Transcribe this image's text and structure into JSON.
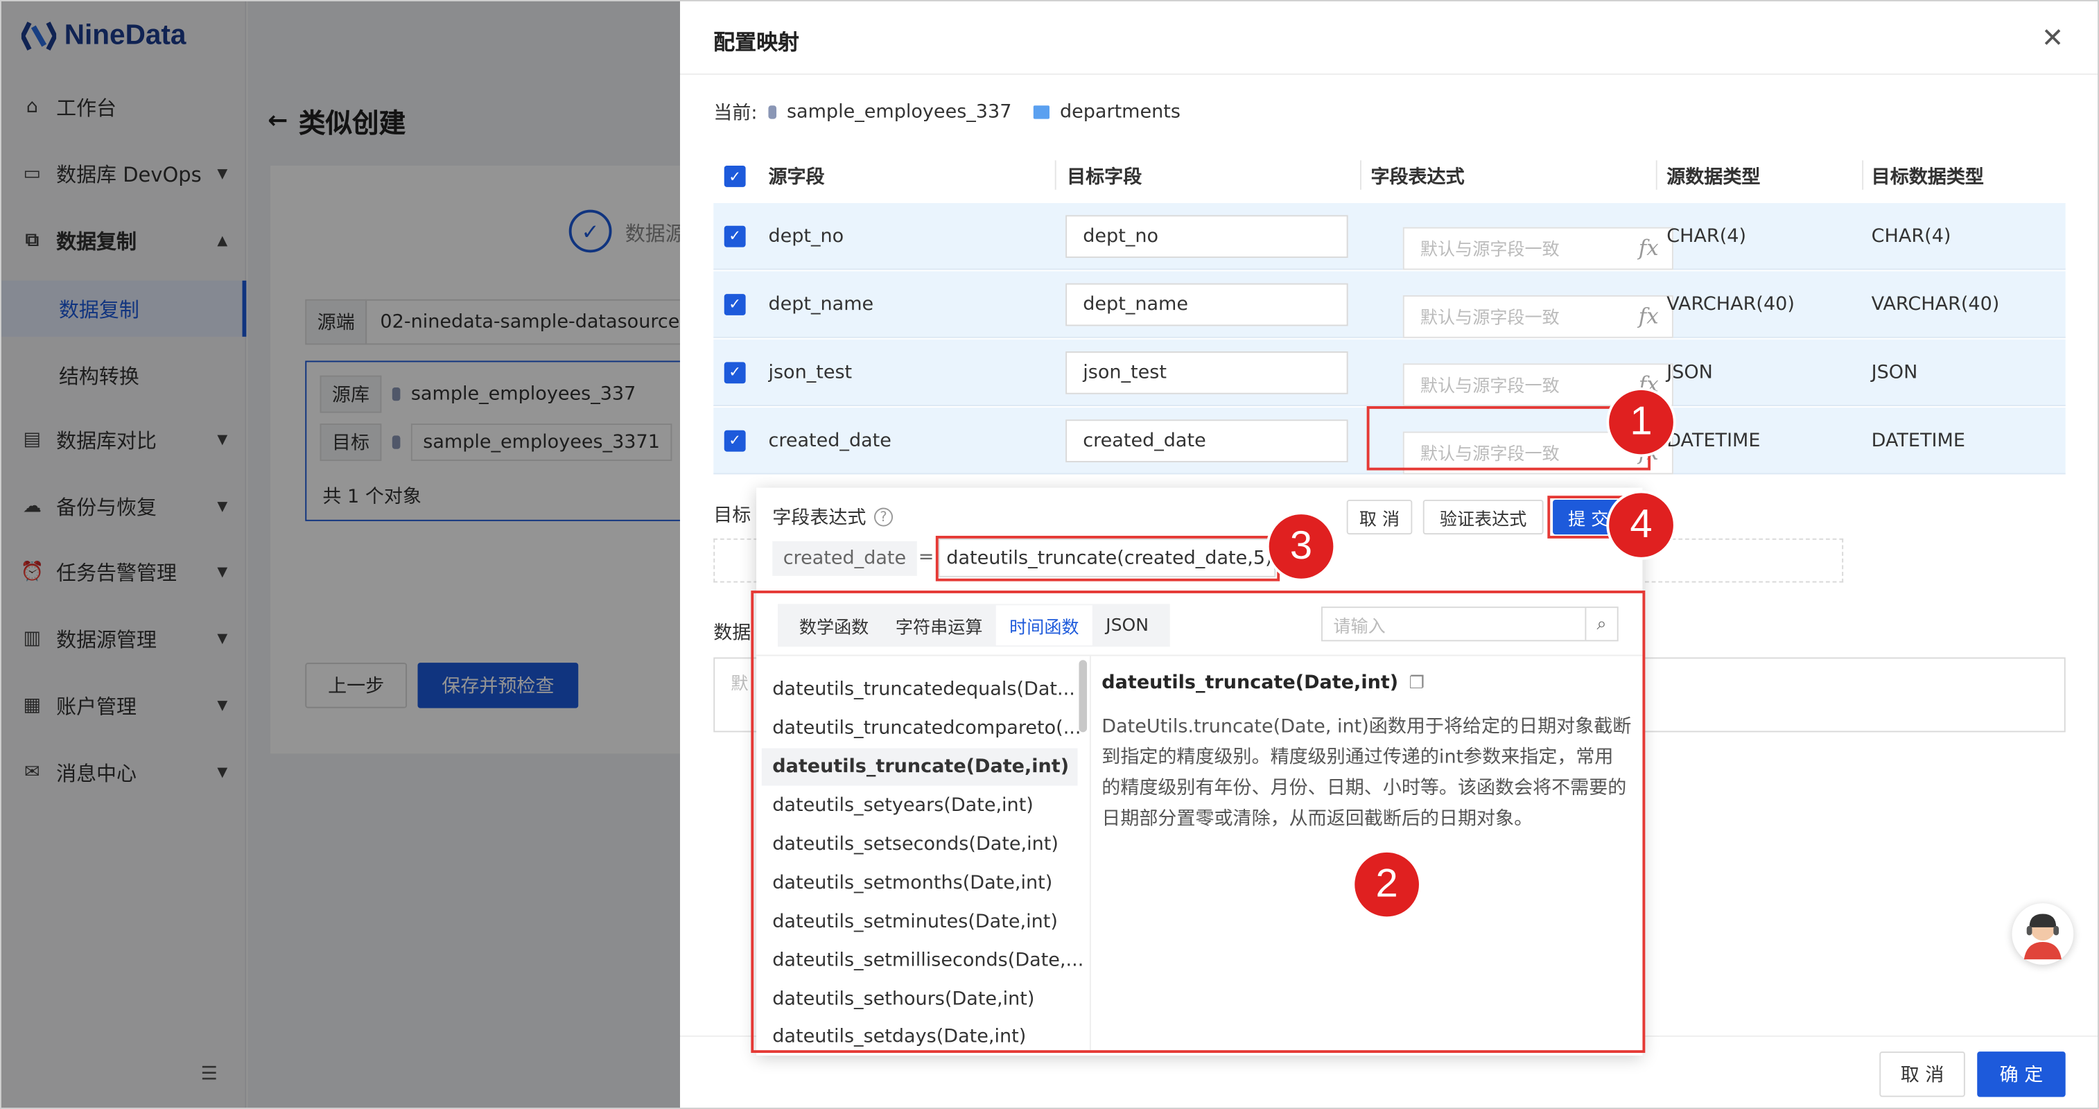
{
  "app": {
    "logo": "NineData"
  },
  "sidebar": {
    "items": [
      {
        "label": "工作台",
        "icon": "home-icon"
      },
      {
        "label": "数据库 DevOps",
        "icon": "monitor-icon"
      },
      {
        "label": "数据复制",
        "icon": "copy-icon"
      },
      {
        "label": "数据库对比",
        "icon": "compare-icon"
      },
      {
        "label": "备份与恢复",
        "icon": "cloud-icon"
      },
      {
        "label": "任务告警管理",
        "icon": "alarm-icon"
      },
      {
        "label": "数据源管理",
        "icon": "database-icon"
      },
      {
        "label": "账户管理",
        "icon": "account-icon"
      },
      {
        "label": "消息中心",
        "icon": "mail-icon"
      }
    ],
    "sub_items": [
      "数据复制",
      "结构转换"
    ]
  },
  "page": {
    "title": "类似创建",
    "step_label": "数据源",
    "source_end_label": "源端",
    "source_end_value": "02-ninedata-sample-datasource",
    "source_db_label": "源库",
    "source_db_value": "sample_employees_337",
    "target_label": "目标",
    "target_value": "sample_employees_3371",
    "object_count": "共 1 个对象",
    "prev_button": "上一步",
    "save_button": "保存并预检查",
    "target_section_label": "目标",
    "data_section_label": "数据",
    "default_placeholder": "默"
  },
  "drawer": {
    "title": "配置映射",
    "current_label": "当前:",
    "current_db": "sample_employees_337",
    "current_table": "departments",
    "columns": [
      "源字段",
      "目标字段",
      "字段表达式",
      "源数据类型",
      "目标数据类型"
    ],
    "expr_placeholder": "默认与源字段一致",
    "rows": [
      {
        "source": "dept_no",
        "target": "dept_no",
        "src_type": "CHAR(4)",
        "tgt_type": "CHAR(4)"
      },
      {
        "source": "dept_name",
        "target": "dept_name",
        "src_type": "VARCHAR(40)",
        "tgt_type": "VARCHAR(40)"
      },
      {
        "source": "json_test",
        "target": "json_test",
        "src_type": "JSON",
        "tgt_type": "JSON"
      },
      {
        "source": "created_date",
        "target": "created_date",
        "src_type": "DATETIME",
        "tgt_type": "DATETIME"
      }
    ],
    "cancel_button": "取 消",
    "ok_button": "确 定"
  },
  "popover": {
    "title": "字段表达式",
    "field_name": "created_date",
    "equals": "=",
    "expression": "dateutils_truncate(created_date,5)",
    "cancel": "取 消",
    "validate": "验证表达式",
    "submit": "提 交",
    "tabs": [
      "数学函数",
      "字符串运算",
      "时间函数",
      "JSON"
    ],
    "active_tab": "时间函数",
    "search_placeholder": "请输入",
    "functions": [
      "dateutils_truncatedequals(Dat...",
      "dateutils_truncatedcompareto(...",
      "dateutils_truncate(Date,int)",
      "dateutils_setyears(Date,int)",
      "dateutils_setseconds(Date,int)",
      "dateutils_setmonths(Date,int)",
      "dateutils_setminutes(Date,int)",
      "dateutils_setmilliseconds(Date,...",
      "dateutils_sethours(Date,int)",
      "dateutils_setdays(Date,int)"
    ],
    "selected_function": "dateutils_truncate(Date,int)",
    "detail_title": "dateutils_truncate(Date,int)",
    "detail_desc": "DateUtils.truncate(Date, int)函数用于将给定的日期对象截断到指定的精度级别。精度级别通过传递的int参数来指定，常用的精度级别有年份、月份、日期、小时等。该函数会将不需要的日期部分置零或清除，从而返回截断后的日期对象。"
  },
  "annotations": [
    "1",
    "2",
    "3",
    "4"
  ],
  "colors": {
    "primary": "#1d5adb",
    "annotation_red": "#e02020",
    "row_highlight": "#eaf4fd"
  }
}
